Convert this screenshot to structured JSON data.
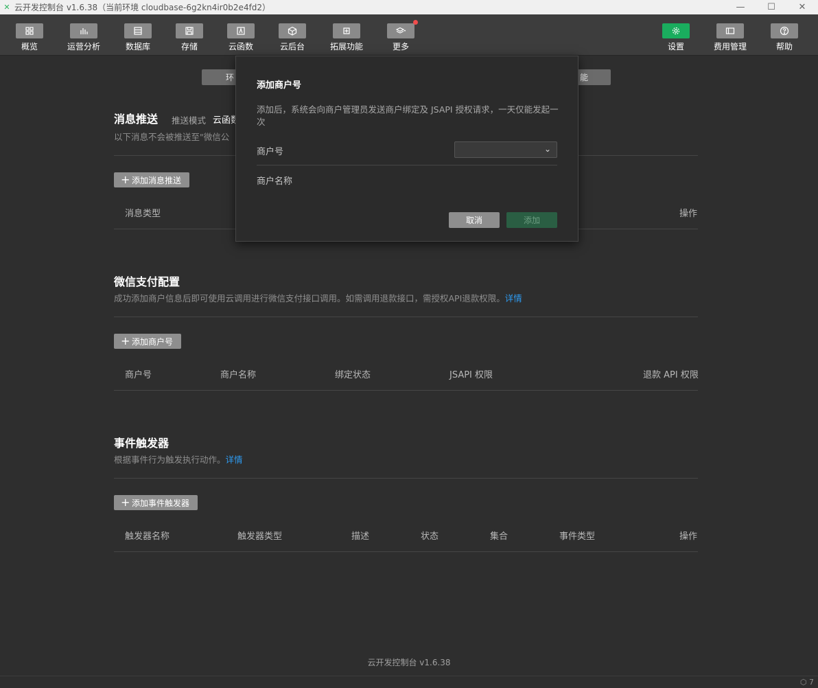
{
  "window": {
    "title": "云开发控制台 v1.6.38（当前环境 cloudbase-6g2kn4ir0b2e4fd2）",
    "minimize": "—",
    "maximize": "☐",
    "close": "✕"
  },
  "toolbar": {
    "items": [
      {
        "label": "概览",
        "icon": "grid-icon"
      },
      {
        "label": "运营分析",
        "icon": "bar-chart-icon"
      },
      {
        "label": "数据库",
        "icon": "database-icon"
      },
      {
        "label": "存储",
        "icon": "save-icon"
      },
      {
        "label": "云函数",
        "icon": "function-icon"
      },
      {
        "label": "云后台",
        "icon": "cube-icon"
      },
      {
        "label": "拓展功能",
        "icon": "plus-box-icon"
      },
      {
        "label": "更多",
        "icon": "layers-icon"
      }
    ],
    "right_items": [
      {
        "label": "设置",
        "icon": "gear-icon"
      },
      {
        "label": "费用管理",
        "icon": "billing-icon"
      },
      {
        "label": "帮助",
        "icon": "help-icon"
      }
    ]
  },
  "tabs": {
    "left_partial": "环",
    "right_partial": "能"
  },
  "message_push": {
    "title": "消息推送",
    "mode_label": "推送模式",
    "mode_value": "云函数",
    "desc": "以下消息不会被推送至\"微信公",
    "add_button": "添加消息推送",
    "col_type": "消息类型",
    "col_action": "操作"
  },
  "wxpay": {
    "title": "微信支付配置",
    "desc": "成功添加商户信息后即可使用云调用进行微信支付接口调用。如需调用退款接口，需授权API退款权限。",
    "link": "详情",
    "add_button": "添加商户号",
    "columns": [
      "商户号",
      "商户名称",
      "绑定状态",
      "JSAPI 权限",
      "退款 API 权限"
    ]
  },
  "triggers": {
    "title": "事件触发器",
    "desc": "根据事件行为触发执行动作。",
    "link": "详情",
    "add_button": "添加事件触发器",
    "columns": [
      "触发器名称",
      "触发器类型",
      "描述",
      "状态",
      "集合",
      "事件类型",
      "操作"
    ]
  },
  "footer": "云开发控制台 v1.6.38",
  "statusbar": {
    "indicator": "⬡ 7"
  },
  "modal": {
    "title": "添加商户号",
    "desc": "添加后，系统会向商户管理员发送商户绑定及 JSAPI 授权请求，一天仅能发起一次",
    "merchant_id_label": "商户号",
    "merchant_id_value": "",
    "merchant_name_label": "商户名称",
    "cancel": "取消",
    "add": "添加"
  }
}
